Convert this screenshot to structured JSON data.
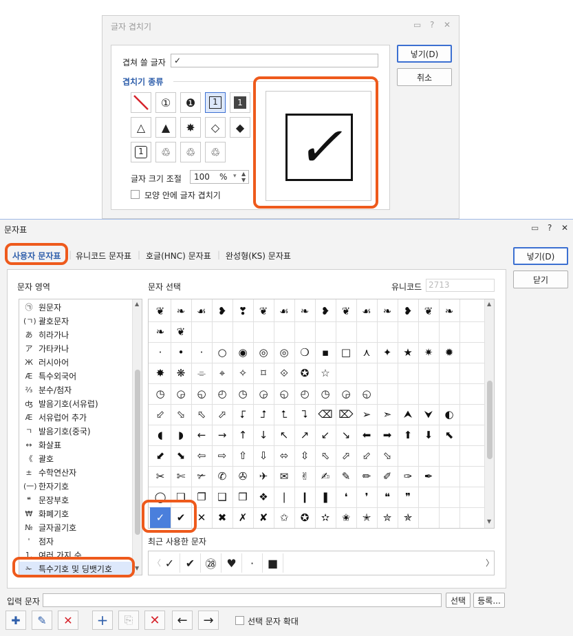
{
  "overlay_dialog": {
    "title": "글자 겹치기",
    "icons": [
      "comment-icon",
      "help-icon",
      "close-icon"
    ],
    "help_symbol": "?",
    "close_symbol": "✕",
    "overlay_label": "겹쳐 쓸 글자",
    "overlay_value": "✓",
    "section_label": "겹치기 종류",
    "types": [
      [
        "slash",
        "①",
        "❶",
        "1⃞",
        "1⃞"
      ],
      [
        "△1",
        "▲1",
        "✸1",
        "◇1",
        "◆1"
      ],
      [
        "▢1",
        "♲1",
        "♲1",
        "♲1"
      ]
    ],
    "size_label": "글자 크기 조절",
    "size_value": "100",
    "size_unit": "%",
    "shape_checkbox_label": "모양 안에 글자 겹치기",
    "preview_char": "✓",
    "insert_button": "넣기(D)",
    "cancel_button": "취소"
  },
  "charmap": {
    "title": "문자표",
    "help_symbol": "?",
    "close_symbol": "✕",
    "tabs": [
      "사용자 문자표",
      "유니코드 문자표",
      "호글(HNC) 문자표",
      "완성형(KS) 문자표"
    ],
    "active_tab": 0,
    "area_label": "문자 영역",
    "select_label": "문자 선택",
    "unicode_label": "유니코드",
    "unicode_value": "2713",
    "areas": [
      {
        "icon": "㉠",
        "label": "원문자"
      },
      {
        "icon": "(ㄱ)",
        "label": "괄호문자"
      },
      {
        "icon": "あ",
        "label": "히라가나"
      },
      {
        "icon": "ア",
        "label": "가타카나"
      },
      {
        "icon": "Ж",
        "label": "러시아어"
      },
      {
        "icon": "Æ",
        "label": "특수외국어"
      },
      {
        "icon": "⅔",
        "label": "분수/첨자"
      },
      {
        "icon": "ʤ",
        "label": "발음기호(서유럽)"
      },
      {
        "icon": "Æ",
        "label": "서유럽어 추가"
      },
      {
        "icon": "ㄱ",
        "label": "발음기호(중국)"
      },
      {
        "icon": "↔",
        "label": "화살표"
      },
      {
        "icon": "《",
        "label": "괄호"
      },
      {
        "icon": "±",
        "label": "수학연산자"
      },
      {
        "icon": "(一)",
        "label": "한자기호"
      },
      {
        "icon": "❝",
        "label": "문장부호"
      },
      {
        "icon": "₩",
        "label": "화폐기호"
      },
      {
        "icon": "№",
        "label": "글자골기호"
      },
      {
        "icon": "'",
        "label": "점자"
      },
      {
        "icon": "1.",
        "label": "여러 가지 수"
      },
      {
        "icon": "✁",
        "label": "특수기호 및 딩뱃기호"
      }
    ],
    "selected_area": 19,
    "grid_rows": [
      [
        "❦",
        "❧",
        "☙",
        "❥",
        "❣",
        "❦",
        "☙",
        "❧",
        "❥",
        "❦",
        "☙",
        "❧",
        "❥",
        "❦",
        "❧"
      ],
      [
        "❧",
        "❦",
        "",
        "",
        "",
        "",
        "",
        "",
        "",
        "",
        "",
        "",
        "",
        "",
        ""
      ],
      [
        "·",
        "•",
        "·",
        "○",
        "◉",
        "◎",
        "◎",
        "❍",
        "▪",
        "□",
        "⋏",
        "✦",
        "★",
        "✷",
        "✹"
      ],
      [
        "✸",
        "❋",
        "⌯",
        "⌖",
        "✧",
        "⌑",
        "⟐",
        "✪",
        "☆",
        "",
        "",
        "",
        "",
        "",
        ""
      ],
      [
        "◷",
        "◶",
        "◵",
        "◴",
        "◷",
        "◶",
        "◵",
        "◴",
        "◷",
        "◶",
        "◵",
        "",
        "",
        "",
        ""
      ],
      [
        "⬃",
        "⬂",
        "⬁",
        "⬀",
        "⮦",
        "⮥",
        "⮤",
        "⮧",
        "⌫",
        "⌦",
        "➢",
        "➣",
        "⮝",
        "⮟",
        "◐"
      ],
      [
        "◖",
        "◗",
        "←",
        "→",
        "↑",
        "↓",
        "↖",
        "↗",
        "↙",
        "↘",
        "⬅",
        "➡",
        "⬆",
        "⬇",
        "⬉"
      ],
      [
        "⬋",
        "⬊",
        "⇦",
        "⇨",
        "⇧",
        "⇩",
        "⬄",
        "⇳",
        "⬁",
        "⬀",
        "⬃",
        "⬂",
        "",
        "",
        ""
      ],
      [
        "✂",
        "✄",
        "✃",
        "✆",
        "✇",
        "✈",
        "✉",
        "✌",
        "✍",
        "✎",
        "✏",
        "✐",
        "✑",
        "✒",
        ""
      ],
      [
        "◯",
        "❏",
        "❐",
        "❑",
        "❒",
        "❖",
        "❘",
        "❙",
        "❚",
        "❛",
        "❜",
        "❝",
        "❞",
        "",
        ""
      ],
      [
        "✓",
        "✔",
        "✕",
        "✖",
        "✗",
        "✘",
        "✩",
        "✪",
        "✫",
        "✬",
        "✭",
        "✮",
        "✯",
        "",
        ""
      ]
    ],
    "selected_cell": [
      10,
      0
    ],
    "recent_label": "최근 사용한 문자",
    "recent_chars": [
      "✓",
      "✔",
      "㉘",
      "♥",
      "·",
      "■"
    ],
    "input_label": "입력 문자",
    "input_value": "",
    "select_button": "선택",
    "register_button": "등록...",
    "expand_label": "선택 문자 확대",
    "insert_button": "넣기(D)",
    "close_button": "닫기",
    "toolbar": [
      "add-set-icon",
      "edit-set-icon",
      "delete-set-icon",
      "add-char-icon",
      "copy-char-icon",
      "delete-char-icon",
      "arrow-left-icon",
      "arrow-right-icon"
    ]
  }
}
